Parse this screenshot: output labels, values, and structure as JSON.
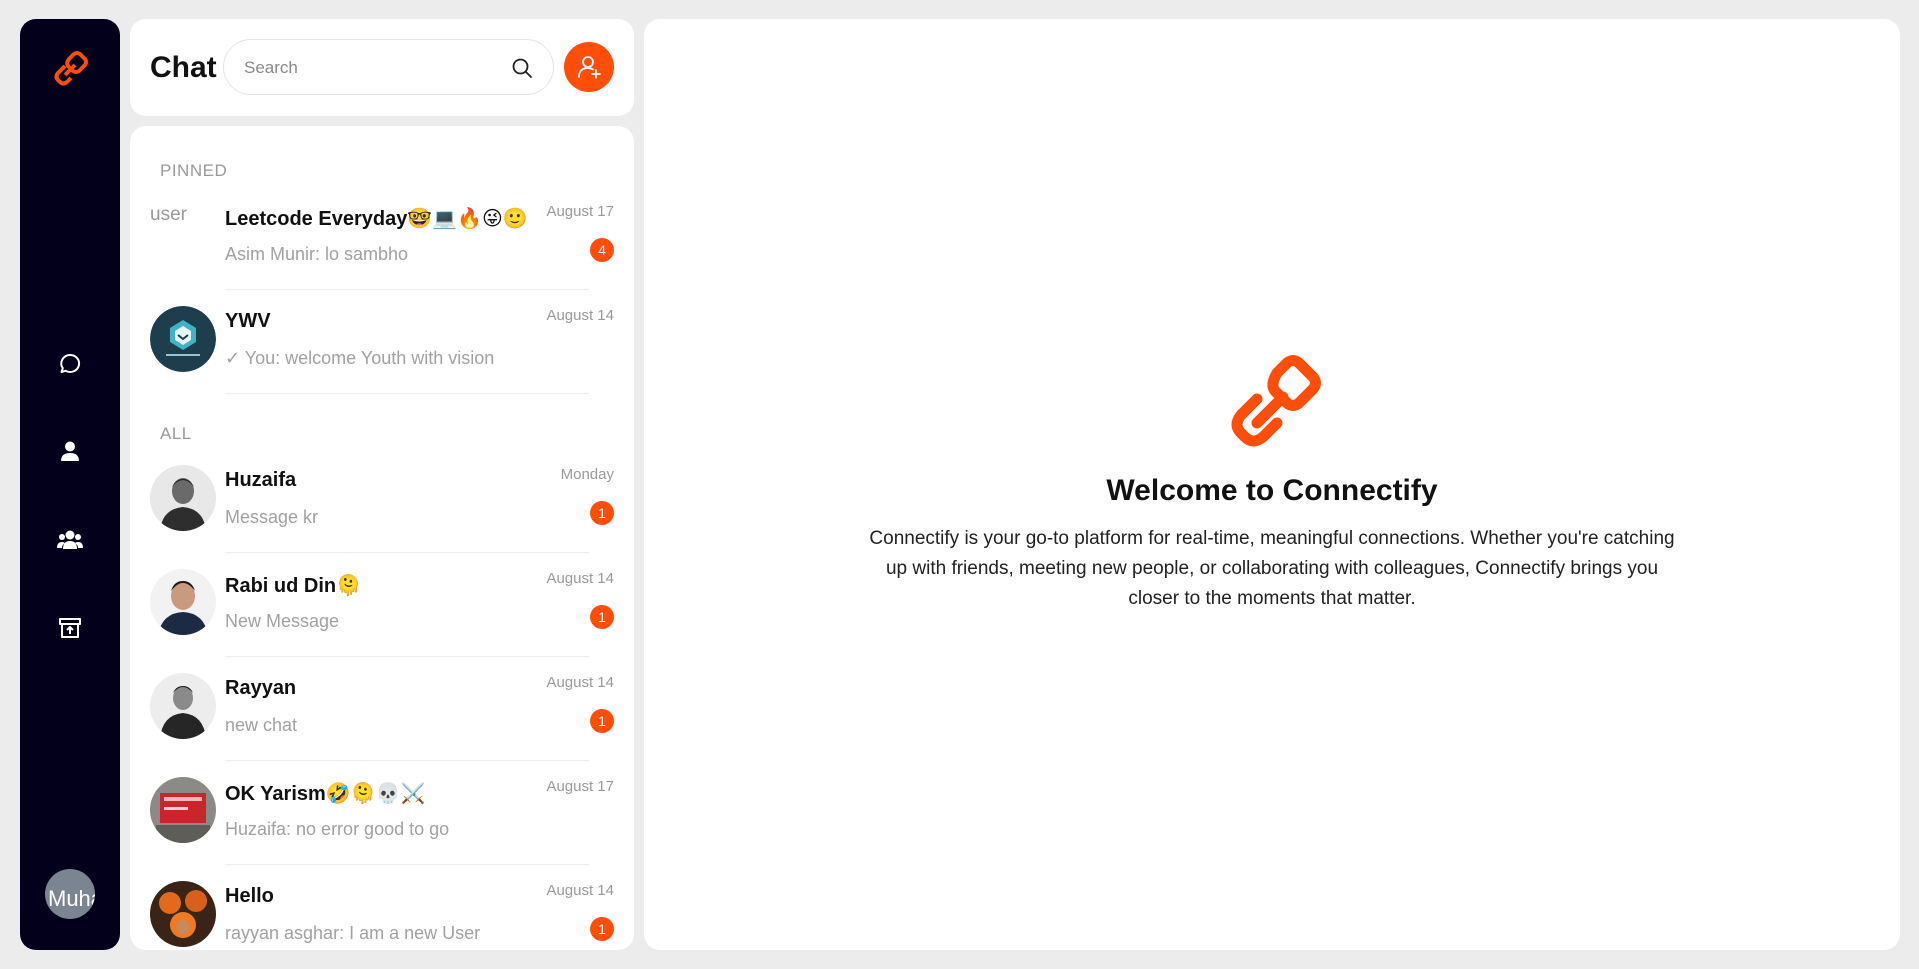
{
  "app": {
    "name": "Connectify",
    "accent": "#ff4d0a",
    "rail_bg": "#02001a"
  },
  "rail": {
    "icons": [
      "link-icon",
      "chat-bubble-icon",
      "user-icon",
      "group-icon",
      "archive-icon"
    ],
    "avatar_alt": "Muha"
  },
  "header": {
    "title": "Chat",
    "search_placeholder": "Search"
  },
  "list": {
    "pinned_label": "PINNED",
    "all_label": "ALL",
    "pinned": [
      {
        "name": "Leetcode Everyday🤓💻🔥😜🙂",
        "message": "Asim Munir: lo sambho",
        "date": "August 17",
        "badge": "4",
        "avatar_alt": "user"
      },
      {
        "name": "YWV",
        "message": "You: welcome Youth with vision",
        "date": "August 14",
        "badge": ""
      }
    ],
    "all": [
      {
        "name": "Huzaifa",
        "message": "Message kr",
        "date": "Monday",
        "badge": "1"
      },
      {
        "name": "Rabi ud Din🫠",
        "message": "New Message",
        "date": "August 14",
        "badge": "1"
      },
      {
        "name": "Rayyan",
        "message": "new chat",
        "date": "August 14",
        "badge": "1"
      },
      {
        "name": "OK Yarism🤣🫠💀⚔️",
        "message": "Huzaifa: no error good to go",
        "date": "August 17",
        "badge": ""
      },
      {
        "name": "Hello",
        "message": "rayyan asghar: I am a new User",
        "date": "August 14",
        "badge": "1"
      }
    ]
  },
  "welcome": {
    "title": "Welcome to Connectify",
    "text": "Connectify is your go-to platform for real-time, meaningful connections. Whether you're catching up with friends, meeting new people, or collaborating with colleagues, Connectify brings you closer to the moments that matter."
  }
}
